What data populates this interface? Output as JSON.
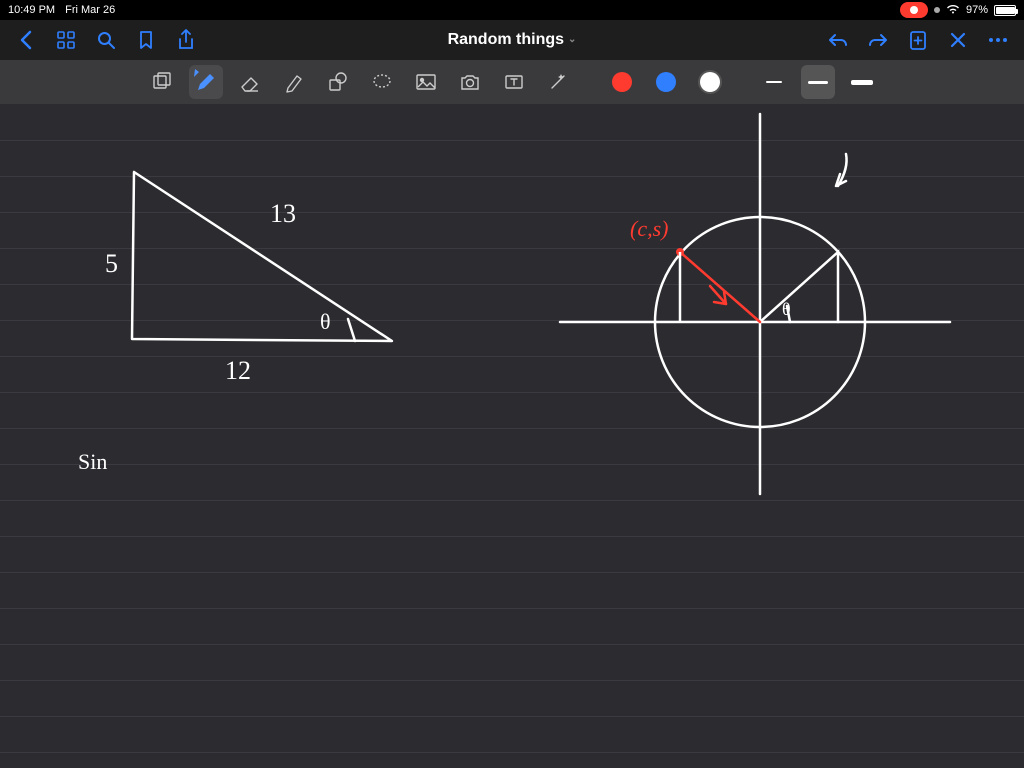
{
  "status": {
    "time": "10:49 PM",
    "date": "Fri Mar 26",
    "battery": "97%"
  },
  "titlebar": {
    "title": "Random things"
  },
  "labels": {
    "side_a": "5",
    "side_b": "12",
    "hypotenuse": "13",
    "angle": "θ",
    "sin": "Sin",
    "coord": "(c,s)",
    "circle_angle": "θ"
  }
}
